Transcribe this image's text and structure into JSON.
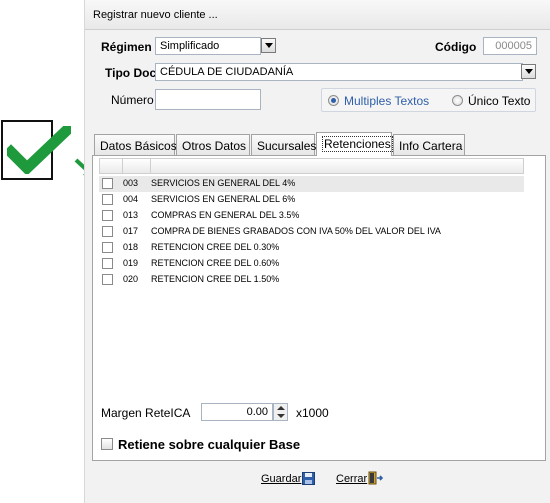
{
  "window": {
    "title": "Registrar nuevo cliente ..."
  },
  "form": {
    "regimen": {
      "label": "Régimen",
      "value": "Simplificado"
    },
    "codigo": {
      "label": "Código",
      "value": "000005"
    },
    "tipo_doc": {
      "label": "Tipo Doc",
      "value": "CÉDULA DE CIUDADANÍA"
    },
    "numero": {
      "label": "Número",
      "value": ""
    },
    "text_mode": {
      "options": [
        "Multiples Textos",
        "Único Texto"
      ],
      "selected": "Multiples Textos"
    }
  },
  "tabs": [
    {
      "label": "Datos Básicos"
    },
    {
      "label": "Otros Datos"
    },
    {
      "label": "Sucursales"
    },
    {
      "label": "Retenciones",
      "active": true
    },
    {
      "label": "Info Cartera"
    }
  ],
  "retenciones": [
    {
      "code": "003",
      "description": "SERVICIOS EN GENERAL DEL 4%",
      "checked": false
    },
    {
      "code": "004",
      "description": "SERVICIOS EN GENERAL DEL 6%",
      "checked": false
    },
    {
      "code": "013",
      "description": "COMPRAS EN GENERAL DEL 3.5%",
      "checked": false
    },
    {
      "code": "017",
      "description": "COMPRA DE BIENES GRABADOS CON IVA 50% DEL VALOR DEL IVA",
      "checked": false
    },
    {
      "code": "018",
      "description": "RETENCION CREE DEL 0.30%",
      "checked": false
    },
    {
      "code": "019",
      "description": "RETENCION CREE DEL 0.60%",
      "checked": false
    },
    {
      "code": "020",
      "description": "RETENCION CREE DEL 1.50%",
      "checked": false
    }
  ],
  "margen": {
    "label": "Margen ReteICA",
    "value": "0.00",
    "unit": "x1000"
  },
  "retiene": {
    "label": "Retiene sobre cualquier Base",
    "checked": false
  },
  "actions": {
    "guardar": "Guardar",
    "cerrar": "Cerrar"
  },
  "colors": {
    "checkmark": "#1e9a3c",
    "accent": "#2e5fa8"
  },
  "icons": [
    "check-mark-icon",
    "pointer-arrow-icon",
    "save-disk-icon",
    "exit-door-icon",
    "radio-icon",
    "dropdown-arrow-icon"
  ]
}
